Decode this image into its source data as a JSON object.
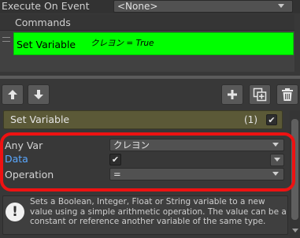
{
  "execute_on_event": {
    "label": "Execute On Event",
    "value": "<None>"
  },
  "commands": {
    "header": "Commands",
    "items": [
      {
        "name": "Set Variable",
        "summary": "クレヨン = True",
        "color": "#00ff00"
      }
    ]
  },
  "toolbar": {
    "up_icon": "arrow-up-icon",
    "down_icon": "arrow-down-icon",
    "add_icon": "plus-icon",
    "duplicate_icon": "duplicate-icon",
    "delete_icon": "trash-icon"
  },
  "command_panel": {
    "title": "Set Variable",
    "count": "(1)",
    "enabled": true
  },
  "properties": {
    "any_var": {
      "label": "Any Var",
      "value": "クレヨン"
    },
    "data": {
      "label": "Data",
      "checked": true
    },
    "operation": {
      "label": "Operation",
      "value": "="
    }
  },
  "help": {
    "icon": "info-icon",
    "text": "Sets a Boolean, Integer, Float or String variable to a new value using a simple arithmetic operation. The value can be a constant or reference another variable of the same type."
  },
  "highlight_color": "#ee1212"
}
